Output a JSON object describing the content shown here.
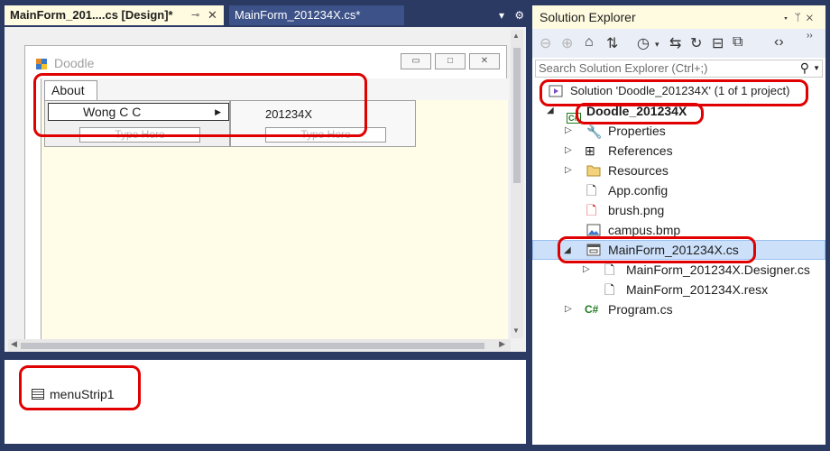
{
  "document_tabs": {
    "active_tab": "MainForm_201....cs [Design]*",
    "inactive_tab": "MainForm_201234X.cs*"
  },
  "form": {
    "title": "Doodle",
    "menu": {
      "top_item": "About",
      "submenu_item": "Wong C C",
      "submenu_placeholder": "Type Here",
      "nested_item": "201234X",
      "nested_placeholder": "Type Here"
    }
  },
  "component_tray": {
    "item": "menuStrip1"
  },
  "solution_explorer": {
    "title": "Solution Explorer",
    "search_placeholder": "Search Solution Explorer (Ctrl+;)",
    "tree": {
      "solution": "Solution 'Doodle_201234X' (1 of 1 project)",
      "project": "Doodle_201234X",
      "properties": "Properties",
      "references": "References",
      "resources": "Resources",
      "app_config": "App.config",
      "brush": "brush.png",
      "campus": "campus.bmp",
      "mainform": "MainForm_201234X.cs",
      "designer": "MainForm_201234X.Designer.cs",
      "resx": "MainForm_201234X.resx",
      "program": "Program.cs"
    },
    "cs_badge": "C#"
  },
  "colors": {
    "highlight": "#e00000",
    "selection": "#cce0fa",
    "chrome": "#2b3a63"
  }
}
